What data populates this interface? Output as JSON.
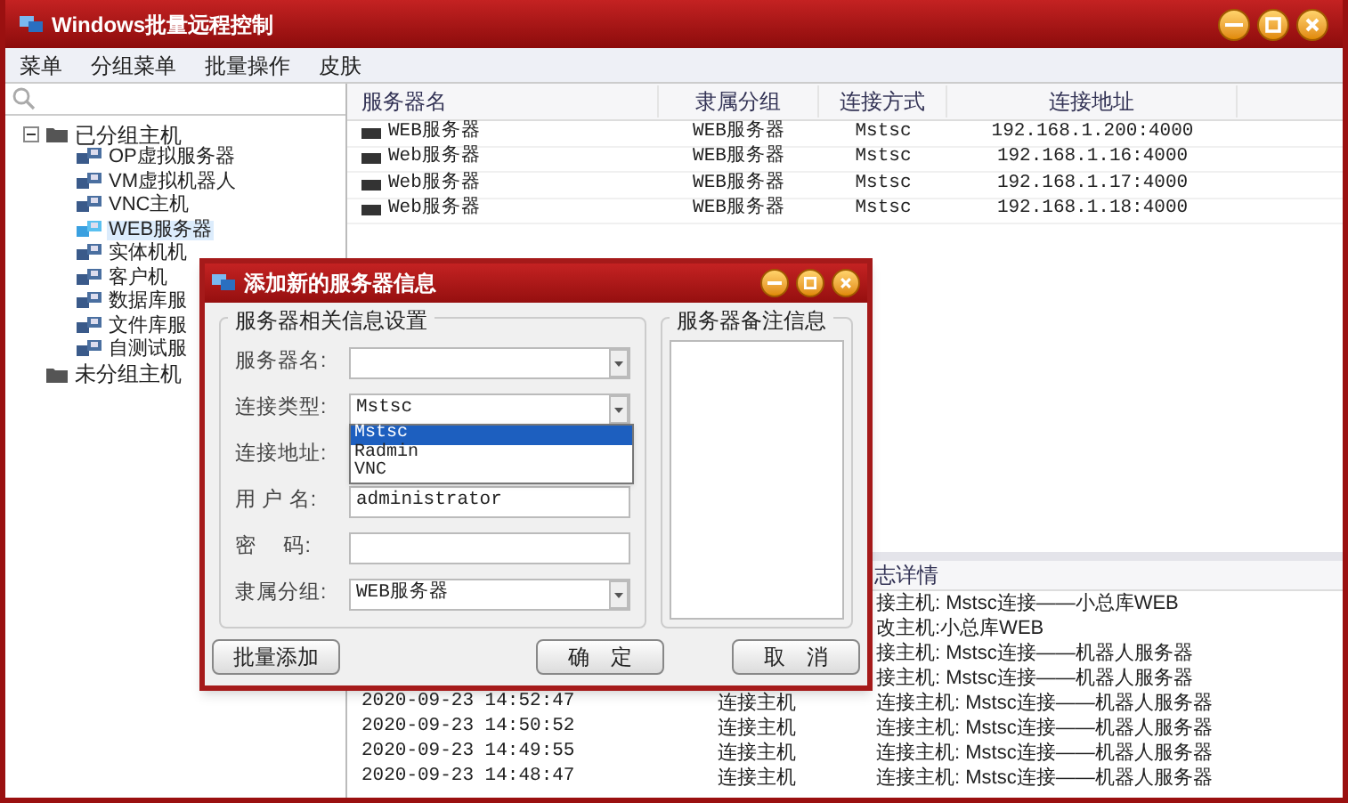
{
  "window": {
    "title": "Windows批量远程控制"
  },
  "menu": [
    "菜单",
    "分组菜单",
    "批量操作",
    "皮肤"
  ],
  "tree": [
    {
      "label": "已分组主机",
      "expanded": true,
      "children": [
        {
          "label": "OP虚拟服务器",
          "selected": false
        },
        {
          "label": "VM虚拟机器人",
          "selected": false
        },
        {
          "label": "VNC主机",
          "selected": false
        },
        {
          "label": "WEB服务器",
          "selected": true
        },
        {
          "label": "实体机机",
          "selected": false
        },
        {
          "label": "客户机",
          "selected": false
        },
        {
          "label": "数据库服",
          "selected": false
        },
        {
          "label": "文件库服",
          "selected": false
        },
        {
          "label": "自测试服",
          "selected": false
        }
      ]
    },
    {
      "label": "未分组主机"
    }
  ],
  "servers": {
    "columns": [
      "服务器名",
      "隶属分组",
      "连接方式",
      "连接地址"
    ],
    "rows": [
      [
        "WEB服务器",
        "WEB服务器",
        "Mstsc",
        "192.168.1.200:4000"
      ],
      [
        "Web服务器",
        "WEB服务器",
        "Mstsc",
        "192.168.1.16:4000"
      ],
      [
        "Web服务器",
        "WEB服务器",
        "Mstsc",
        "192.168.1.17:4000"
      ],
      [
        "Web服务器",
        "WEB服务器",
        "Mstsc",
        "192.168.1.18:4000"
      ]
    ]
  },
  "log": {
    "header": "志详情",
    "rows": [
      {
        "detail": "接主机: Mstsc连接——小总库WEB"
      },
      {
        "detail": "改主机:小总库WEB"
      },
      {
        "detail": "接主机: Mstsc连接——机器人服务器"
      },
      {
        "detail": "接主机: Mstsc连接——机器人服务器"
      },
      {
        "time": "2020-09-23 14:52:47",
        "type": "连接主机",
        "detail": "连接主机: Mstsc连接——机器人服务器"
      },
      {
        "time": "2020-09-23 14:50:52",
        "type": "连接主机",
        "detail": "连接主机: Mstsc连接——机器人服务器"
      },
      {
        "time": "2020-09-23 14:49:55",
        "type": "连接主机",
        "detail": "连接主机: Mstsc连接——机器人服务器"
      },
      {
        "time": "2020-09-23 14:48:47",
        "type": "连接主机",
        "detail": "连接主机: Mstsc连接——机器人服务器"
      }
    ]
  },
  "dialog": {
    "title": "添加新的服务器信息",
    "settings_group": "服务器相关信息设置",
    "notes_group": "服务器备注信息",
    "fields": [
      {
        "label": "服务器名:",
        "kind": "combo"
      },
      {
        "label": "连接类型:",
        "kind": "combo",
        "value": "Mstsc",
        "options": [
          {
            "label": "Mstsc",
            "selected": true
          },
          {
            "label": "Radmin",
            "selected": false
          },
          {
            "label": "VNC",
            "selected": false
          }
        ]
      },
      {
        "label": "连接地址:",
        "kind": "text"
      },
      {
        "label": "用 户 名:",
        "kind": "text",
        "value": "administrator"
      },
      {
        "label": "密　 码:",
        "kind": "text"
      },
      {
        "label": "隶属分组:",
        "kind": "combo",
        "value": "WEB服务器"
      }
    ],
    "buttons": [
      "批量添加",
      "确　定",
      "取　消"
    ]
  }
}
